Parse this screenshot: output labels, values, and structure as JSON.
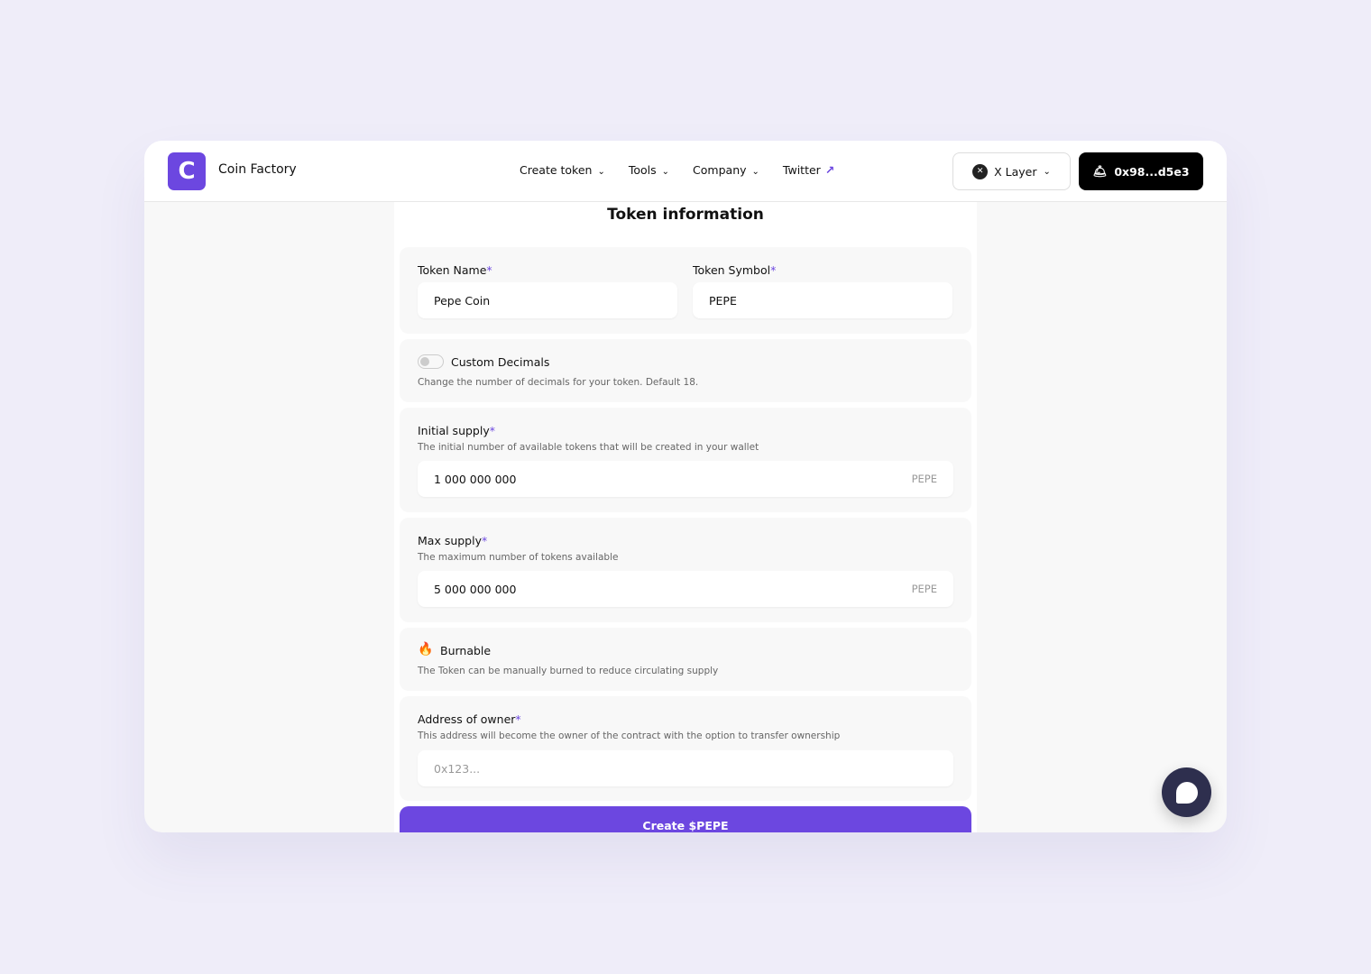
{
  "header": {
    "brand": "Coin Factory",
    "logo_letter": "C",
    "nav": [
      {
        "label": "Create token"
      },
      {
        "label": "Tools"
      },
      {
        "label": "Company"
      },
      {
        "label": "Twitter"
      }
    ],
    "network": "X Layer",
    "wallet": "0x98...d5e3"
  },
  "form": {
    "title": "Token information",
    "token_name": {
      "label": "Token Name",
      "value": "Pepe Coin"
    },
    "token_symbol": {
      "label": "Token Symbol",
      "value": "PEPE"
    },
    "decimals": {
      "label": "Custom Decimals",
      "description": "Change the number of decimals for your token. Default 18.",
      "enabled": false
    },
    "initial_supply": {
      "label": "Initial supply",
      "description": "The initial number of available tokens that will be created in your wallet",
      "value": "1 000 000 000",
      "suffix": "PEPE"
    },
    "max_supply": {
      "label": "Max supply",
      "description": "The maximum number of tokens available",
      "value": "5 000 000 000",
      "suffix": "PEPE"
    },
    "burnable": {
      "label": "Burnable",
      "description": "The Token can be manually burned to reduce circulating supply"
    },
    "owner": {
      "label": "Address of owner",
      "description": "This address will become the owner of the contract with the option to transfer ownership",
      "placeholder": "0x123..."
    },
    "submit": "Create $PEPE",
    "required_mark": "*"
  },
  "colors": {
    "accent": "#6c47e0",
    "background": "#efedf9"
  }
}
